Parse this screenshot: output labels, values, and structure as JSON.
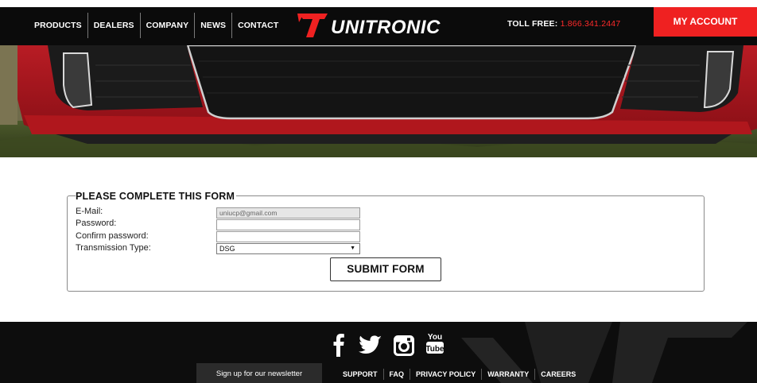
{
  "header": {
    "nav": [
      {
        "label": "PRODUCTS"
      },
      {
        "label": "DEALERS"
      },
      {
        "label": "COMPANY"
      },
      {
        "label": "NEWS"
      },
      {
        "label": "CONTACT"
      }
    ],
    "logo_text": "UNITRONIC",
    "toll_label": "TOLL FREE:",
    "toll_number": "1.866.341.2447",
    "account_label": "MY ACCOUNT"
  },
  "form": {
    "title": "PLEASE COMPLETE THIS FORM",
    "email_label": "E-Mail:",
    "email_value": "uniucp@gmail.com",
    "password_label": "Password:",
    "password_value": "",
    "confirm_label": "Confirm password:",
    "confirm_value": "",
    "transmission_label": "Transmission Type:",
    "transmission_value": "DSG",
    "submit_label": "SUBMIT FORM"
  },
  "footer": {
    "newsletter_label": "Sign up for our newsletter",
    "links": [
      {
        "label": "SUPPORT"
      },
      {
        "label": "FAQ"
      },
      {
        "label": "PRIVACY POLICY"
      },
      {
        "label": "WARRANTY"
      },
      {
        "label": "CAREERS"
      }
    ],
    "youtube_text_top": "You",
    "youtube_text_bottom": "Tube"
  },
  "colors": {
    "brand_red": "#ef2121",
    "toll_red": "#ff2a2a",
    "header_bg": "#0b0b0b",
    "footer_bg": "#0d0d0d"
  }
}
